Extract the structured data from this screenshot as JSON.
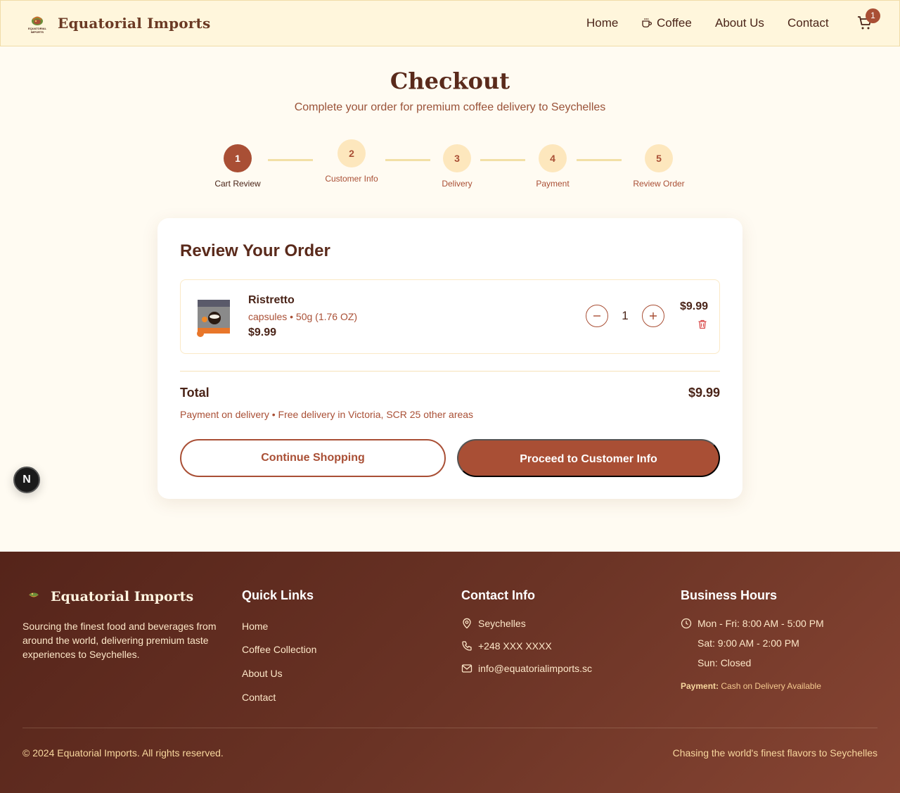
{
  "header": {
    "brand": "Equatorial Imports",
    "logo_text": "EQUATORIAL IMPORTS",
    "nav": [
      "Home",
      "Coffee",
      "About Us",
      "Contact"
    ],
    "cart_count": "1"
  },
  "page": {
    "title": "Checkout",
    "subtitle": "Complete your order for premium coffee delivery to Seychelles"
  },
  "steps": [
    {
      "num": "1",
      "label": "Cart Review",
      "active": true
    },
    {
      "num": "2",
      "label": "Customer Info",
      "active": false
    },
    {
      "num": "3",
      "label": "Delivery",
      "active": false
    },
    {
      "num": "4",
      "label": "Payment",
      "active": false
    },
    {
      "num": "5",
      "label": "Review Order",
      "active": false
    }
  ],
  "order": {
    "title": "Review Your Order",
    "item": {
      "name": "Ristretto",
      "meta": "capsules • 50g (1.76 OZ)",
      "price": "$9.99",
      "quantity": "1",
      "line_total": "$9.99"
    },
    "total_label": "Total",
    "total_value": "$9.99",
    "note": "Payment on delivery • Free delivery in Victoria, SCR 25 other areas",
    "continue_label": "Continue Shopping",
    "proceed_label": "Proceed to Customer Info"
  },
  "floating_badge": "N",
  "footer": {
    "brand": "Equatorial Imports",
    "description": "Sourcing the finest food and beverages from around the world, delivering premium taste experiences to Seychelles.",
    "quick_links_title": "Quick Links",
    "quick_links": [
      "Home",
      "Coffee Collection",
      "About Us",
      "Contact"
    ],
    "contact_title": "Contact Info",
    "contact": {
      "location": "Seychelles",
      "phone": "+248 XXX XXXX",
      "email": "info@equatorialimports.sc"
    },
    "hours_title": "Business Hours",
    "hours": [
      "Mon - Fri: 8:00 AM - 5:00 PM",
      "Sat: 9:00 AM - 2:00 PM",
      "Sun: Closed"
    ],
    "payment_label": "Payment:",
    "payment_text": "Cash on Delivery Available",
    "copyright": "© 2024 Equatorial Imports. All rights reserved.",
    "tagline": "Chasing the world's finest flavors to Seychelles"
  },
  "colors": {
    "accent": "#a94f35",
    "header_bg": "#fff6dc",
    "page_bg": "#fffbf2",
    "footer_bg": "#6a3325"
  }
}
